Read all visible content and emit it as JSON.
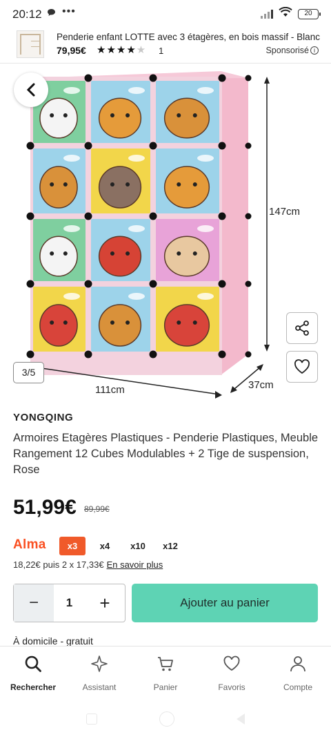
{
  "status_bar": {
    "time": "20:12",
    "notification_icon": "chat-bubble-icon",
    "more": "•••",
    "battery": "20"
  },
  "sponsored": {
    "title": "Penderie enfant LOTTE avec 3 étagères, en bois massif - Blanc",
    "price": "79,95€",
    "rating": 4,
    "rating_max": 5,
    "review_count": "1",
    "label": "Sponsorisé"
  },
  "gallery": {
    "back_icon": "chevron-left-icon",
    "counter": "3/5",
    "dim_height": "147cm",
    "dim_width": "111cm",
    "dim_depth": "37cm",
    "share_icon": "share-icon",
    "favorite_icon": "heart-icon"
  },
  "product": {
    "brand": "YONGQING",
    "title": "Armoires Etagères Plastiques - Penderie Plastiques, Meuble Rangement 12 Cubes Modulables + 2 Tige de suspension, Rose",
    "price": "51,99€",
    "old_price": "89,99€"
  },
  "payment": {
    "provider": "Alma",
    "options": [
      "x3",
      "x4",
      "x10",
      "x12"
    ],
    "selected": "x3",
    "note": "18,22€ puis 2 x 17,33€",
    "link": "En savoir plus"
  },
  "cart": {
    "quantity": "1",
    "minus": "−",
    "plus": "+",
    "add_label": "Ajouter au panier"
  },
  "delivery": {
    "text": "À domicile - gratuit"
  },
  "nav": {
    "items": [
      {
        "label": "Rechercher",
        "icon": "search-icon"
      },
      {
        "label": "Assistant",
        "icon": "sparkle-icon"
      },
      {
        "label": "Panier",
        "icon": "cart-icon"
      },
      {
        "label": "Favoris",
        "icon": "heart-icon"
      },
      {
        "label": "Compte",
        "icon": "user-icon"
      }
    ]
  },
  "colors": {
    "accent": "#5ed3b4",
    "alma": "#fa5022",
    "cube_frame": "#f3b9cc"
  }
}
